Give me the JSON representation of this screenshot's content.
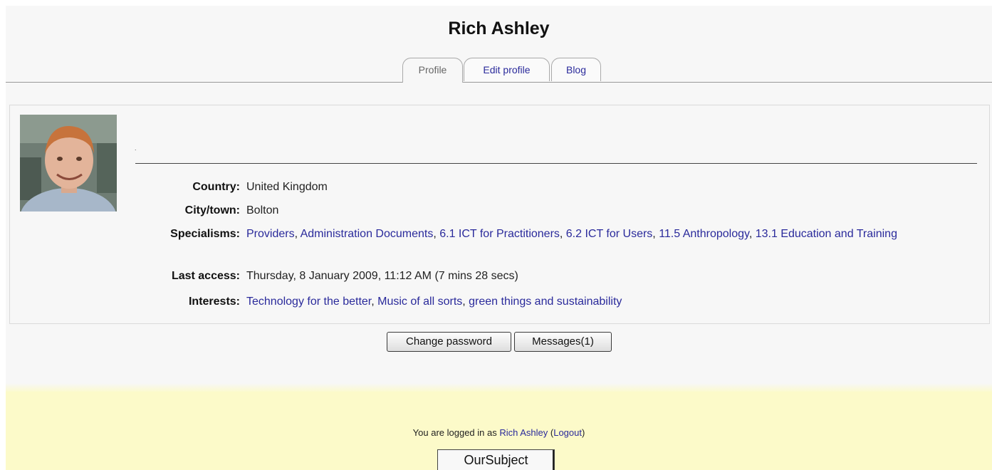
{
  "header": {
    "title": "Rich Ashley",
    "tabs": [
      {
        "label": "Profile",
        "selected": true
      },
      {
        "label": "Edit profile",
        "selected": false
      },
      {
        "label": "Blog",
        "selected": false
      }
    ]
  },
  "profile": {
    "avatar_icon": "user-photo",
    "description": ".",
    "fields": {
      "country": {
        "label": "Country:",
        "value": "United Kingdom"
      },
      "city": {
        "label": "City/town:",
        "value": "Bolton"
      },
      "specialisms": {
        "label": "Specialisms:",
        "items": [
          "Providers",
          "Administration Documents",
          "6.1 ICT for Practitioners",
          "6.2 ICT for Users",
          "11.5 Anthropology",
          "13.1 Education and Training"
        ]
      },
      "last_access": {
        "label": "Last access:",
        "value": "Thursday, 8 January 2009, 11:12 AM  (7 mins 28 secs)"
      },
      "interests": {
        "label": "Interests:",
        "items": [
          "Technology for the better",
          "Music of all sorts",
          "green things and sustainability"
        ]
      }
    }
  },
  "buttons": {
    "change_password": "Change password",
    "messages": "Messages(1)"
  },
  "footer": {
    "logged_in_prefix": "You are logged in as ",
    "user_name": "Rich Ashley",
    "logout_open": " (",
    "logout_label": "Logout",
    "logout_close": ")",
    "home_button": "OurSubject"
  },
  "colors": {
    "link": "#2a2a9b",
    "footer_bg": "#fcfac9",
    "page_bg": "#f7f7f7"
  }
}
